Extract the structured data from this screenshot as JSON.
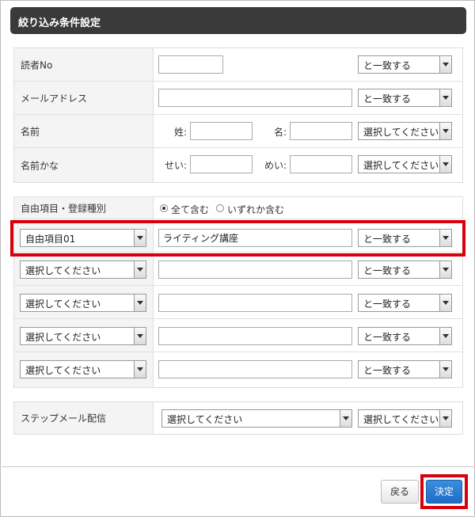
{
  "title": "絞り込み条件設定",
  "match_options": {
    "exact": "と一致する"
  },
  "select_placeholder": "選択してください",
  "reader_no": {
    "label": "読者No",
    "value": "",
    "match": "と一致する"
  },
  "email": {
    "label": "メールアドレス",
    "value": "",
    "match": "と一致する"
  },
  "name": {
    "label": "名前",
    "last_label": "姓:",
    "first_label": "名:",
    "last_value": "",
    "first_value": "",
    "condition": "選択してください"
  },
  "name_kana": {
    "label": "名前かな",
    "last_label": "せい:",
    "first_label": "めい:",
    "last_value": "",
    "first_value": "",
    "condition": "選択してください"
  },
  "free_items": {
    "label": "自由項目・登録種別",
    "radio_all": "全て含む",
    "radio_any": "いずれか含む",
    "selected_radio": "all",
    "rows": [
      {
        "field": "自由項目01",
        "value": "ライティング講座",
        "match": "と一致する"
      },
      {
        "field": "選択してください",
        "value": "",
        "match": "と一致する"
      },
      {
        "field": "選択してください",
        "value": "",
        "match": "と一致する"
      },
      {
        "field": "選択してください",
        "value": "",
        "match": "と一致する"
      },
      {
        "field": "選択してください",
        "value": "",
        "match": "と一致する"
      }
    ]
  },
  "step_mail": {
    "label": "ステップメール配信",
    "value": "選択してください",
    "condition": "選択してください"
  },
  "buttons": {
    "back": "戻る",
    "submit": "決定"
  },
  "colors": {
    "highlight": "#d9000d",
    "primary": "#1f6cc4",
    "titlebar": "#3a3a3a"
  }
}
